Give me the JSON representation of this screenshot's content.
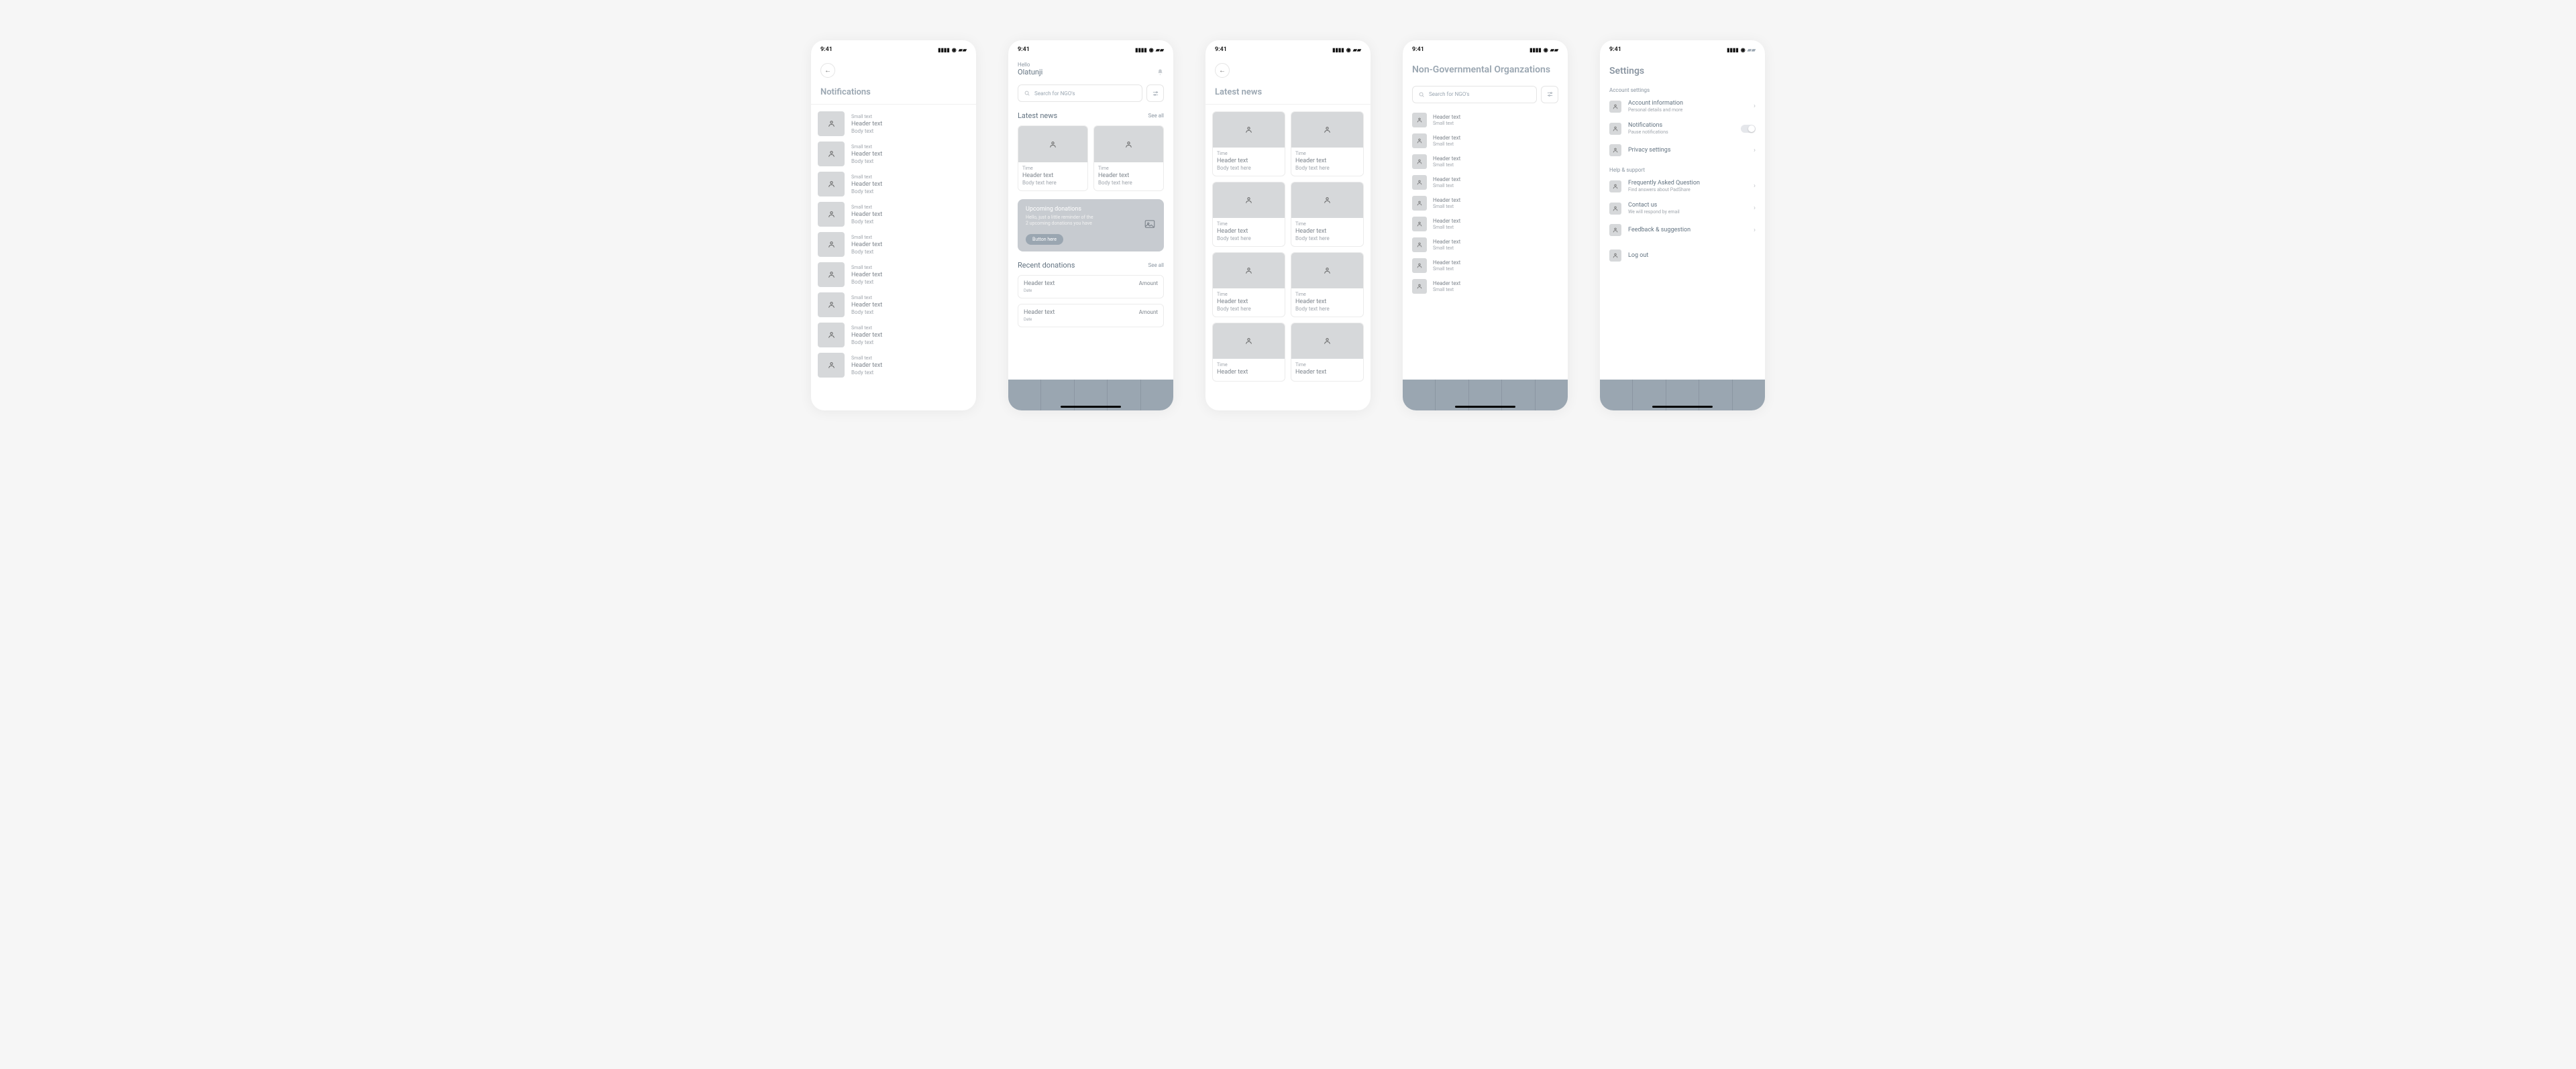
{
  "statusbar": {
    "time": "9:41"
  },
  "notifications": {
    "title": "Notifications",
    "items": [
      {
        "small": "Small text",
        "header": "Header text",
        "body": "Body text"
      },
      {
        "small": "Small text",
        "header": "Header text",
        "body": "Body text"
      },
      {
        "small": "Small text",
        "header": "Header text",
        "body": "Body text"
      },
      {
        "small": "Small text",
        "header": "Header text",
        "body": "Body text"
      },
      {
        "small": "Small text",
        "header": "Header text",
        "body": "Body text"
      },
      {
        "small": "Small text",
        "header": "Header text",
        "body": "Body text"
      },
      {
        "small": "Small text",
        "header": "Header text",
        "body": "Body text"
      },
      {
        "small": "Small text",
        "header": "Header text",
        "body": "Body text"
      },
      {
        "small": "Small text",
        "header": "Header text",
        "body": "Body text"
      }
    ]
  },
  "home": {
    "hello": "Hello",
    "username": "Olatunji",
    "search_placeholder": "Search for NGO's",
    "latest_news_title": "Latest news",
    "see_all": "See all",
    "news": [
      {
        "time": "Time",
        "header": "Header text",
        "body": "Body text here"
      },
      {
        "time": "Time",
        "header": "Header text",
        "body": "Body text here"
      }
    ],
    "banner": {
      "title": "Upcoming donations",
      "body_line1": "Hello, just a little reminder of the",
      "body_line2": "2 upcoming donations you have",
      "button": "Button here"
    },
    "recent_title": "Recent donations",
    "donations": [
      {
        "header": "Header text",
        "date": "Date",
        "amount": "Amount"
      },
      {
        "header": "Header text",
        "date": "Date",
        "amount": "Amount"
      }
    ]
  },
  "latest_news": {
    "title": "Latest news",
    "cards": [
      {
        "time": "Time",
        "header": "Header text",
        "body": "Body text here"
      },
      {
        "time": "Time",
        "header": "Header text",
        "body": "Body text here"
      },
      {
        "time": "Time",
        "header": "Header text",
        "body": "Body text here"
      },
      {
        "time": "Time",
        "header": "Header text",
        "body": "Body text here"
      },
      {
        "time": "Time",
        "header": "Header text",
        "body": "Body text here"
      },
      {
        "time": "Time",
        "header": "Header text",
        "body": "Body text here"
      },
      {
        "time": "Time",
        "header": "Header text",
        "body": ""
      },
      {
        "time": "Time",
        "header": "Header text",
        "body": ""
      }
    ]
  },
  "ngo": {
    "title": "Non-Governmental Organzations",
    "search_placeholder": "Search for NGO's",
    "items": [
      {
        "header": "Header text",
        "small": "Small text"
      },
      {
        "header": "Header text",
        "small": "Small text"
      },
      {
        "header": "Header text",
        "small": "Small text"
      },
      {
        "header": "Header text",
        "small": "Small text"
      },
      {
        "header": "Header text",
        "small": "Small text"
      },
      {
        "header": "Header text",
        "small": "Small text"
      },
      {
        "header": "Header text",
        "small": "Small text"
      },
      {
        "header": "Header text",
        "small": "Small text"
      },
      {
        "header": "Header text",
        "small": "Small text"
      }
    ]
  },
  "settings": {
    "title": "Settings",
    "section1": "Account settings",
    "account_info": {
      "label": "Account information",
      "sub": "Personal details and more"
    },
    "notifications": {
      "label": "Notifications",
      "sub": "Pause notifications"
    },
    "privacy": {
      "label": "Privacy  settings"
    },
    "section2": "Help & support",
    "faq": {
      "label": "Frequently Asked Question",
      "sub": "Find answers about PadShare"
    },
    "contact": {
      "label": "Contact us",
      "sub": "We will respond by email"
    },
    "feedback": {
      "label": "Feedback & suggestion"
    },
    "logout": {
      "label": "Log out"
    }
  }
}
